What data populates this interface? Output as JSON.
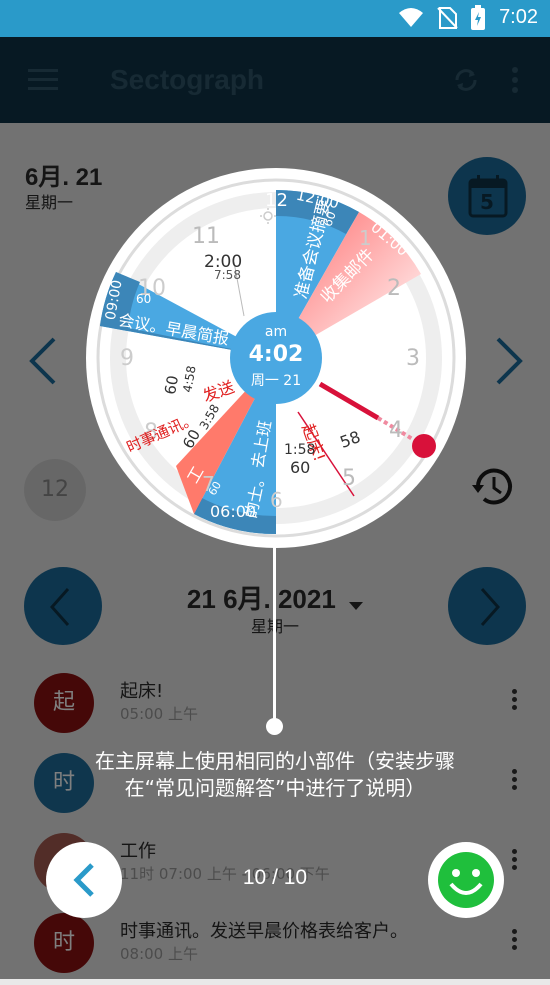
{
  "status_bar": {
    "time": "7:02"
  },
  "app_bar": {
    "title": "Sectograph"
  },
  "header": {
    "date": "6月. 21",
    "weekday": "星期一",
    "calendar_day": "5"
  },
  "left_badge": "12",
  "date_nav": {
    "date": "21 6月. 2021",
    "weekday": "星期一"
  },
  "events": [
    {
      "avatar": "起",
      "title": "起床!",
      "time": "05:00 上午",
      "color": "#8b1010"
    },
    {
      "avatar": "时",
      "title": "",
      "time": "",
      "color": "#1f6d9a"
    },
    {
      "avatar": "",
      "title": "工作",
      "time": "11时  07:00 上午 - 06:00 下午",
      "color": "#a55a50"
    },
    {
      "avatar": "时",
      "title": "时事通讯。发送早晨价格表给客户。",
      "time": "08:00 上午",
      "color": "#8b1010"
    }
  ],
  "dial": {
    "ampm": "am",
    "time": "4:02",
    "day": "周一 21",
    "hour_labels": [
      "12",
      "1",
      "2",
      "3",
      "4",
      "5",
      "6",
      "7",
      "8",
      "9",
      "10",
      "11"
    ],
    "event_labels": [
      {
        "text": "准备会议摘要",
        "color": "#ffffff"
      },
      {
        "text": "收集邮件",
        "color": "#ffffff"
      },
      {
        "text": "会议。早晨简报",
        "color": "#ffffff"
      },
      {
        "text": "时事通讯。",
        "color": "#e02020"
      },
      {
        "text": "发送",
        "color": "#e02020"
      },
      {
        "text": "起床!",
        "color": "#e02020"
      },
      {
        "text": "去上班",
        "color": "#ffffff"
      },
      {
        "text": "的士。",
        "color": "#ffffff"
      },
      {
        "text": "工",
        "color": "#ffffff"
      }
    ],
    "rim_labels": [
      "12:00",
      "01:00",
      "06:00",
      "09:00"
    ],
    "small_labels": [
      "2:00",
      "7:58",
      "4:58",
      "3:58",
      "1:58",
      "60",
      "60",
      "58",
      "60",
      "60",
      "60",
      "60",
      "60"
    ]
  },
  "tutorial": {
    "caption_line1": "在主屏幕上使用相同的小部件（安装步骤",
    "caption_line2": "在“常见问题解答”中进行了说明）",
    "pager": "10 / 10"
  },
  "colors": {
    "accent": "#2a9ac9",
    "appbar": "#0f3346",
    "blue_sector": "#4aa8e2",
    "red": "#d8113a"
  }
}
